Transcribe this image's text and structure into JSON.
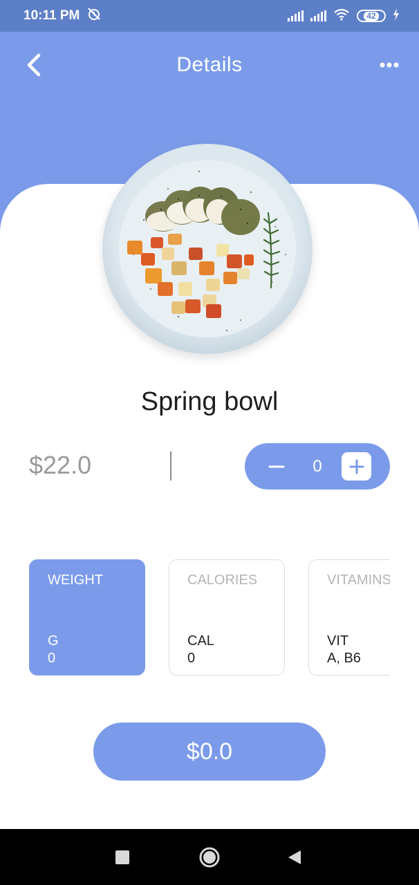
{
  "status_bar": {
    "time": "10:11 PM",
    "battery": "42",
    "icons": [
      "alarm-off-icon",
      "signal-icon",
      "signal-icon",
      "wifi-icon",
      "battery-icon",
      "charging-icon"
    ]
  },
  "header": {
    "title": "Details",
    "back_icon": "chevron-left-icon",
    "more_icon": "more-horizontal-icon"
  },
  "product": {
    "name": "Spring bowl",
    "price": "$22.0",
    "image": "plate-of-sliced-chicken-with-roasted-vegetables"
  },
  "quantity": {
    "value": "0",
    "minus_icon": "minus-icon",
    "plus_icon": "plus-icon"
  },
  "nutrition_cards": [
    {
      "title": "WEIGHT",
      "unit": "G",
      "value": "0",
      "active": true
    },
    {
      "title": "CALORIES",
      "unit": "CAL",
      "value": "0",
      "active": false
    },
    {
      "title": "VITAMINS",
      "unit": "VIT",
      "value": "A, B6",
      "active": false
    }
  ],
  "total_button": {
    "label": "$0.0"
  },
  "colors": {
    "accent": "#7b9bea",
    "status_bar": "#5d7fc7",
    "text_dark": "#1e1e1e",
    "text_muted": "#9a9a9a"
  },
  "nav_bar": {
    "icons": [
      "recent-apps-icon",
      "home-icon",
      "back-icon"
    ]
  }
}
